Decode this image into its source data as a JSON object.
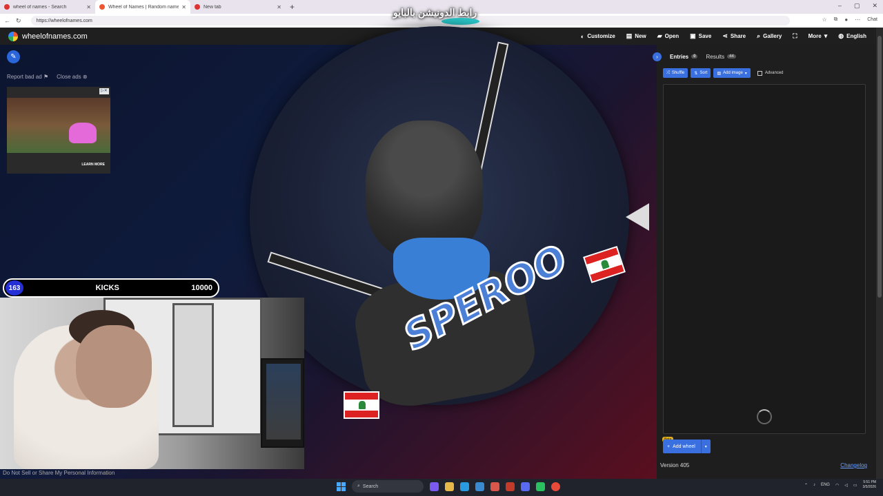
{
  "browser": {
    "tabs": [
      {
        "title": "wheel of names - Search",
        "active": false,
        "color": "#d33"
      },
      {
        "title": "Wheel of Names | Random name",
        "active": true,
        "color": "#e53"
      },
      {
        "title": "New tab",
        "active": false,
        "color": "#d33"
      }
    ],
    "new_tab": "+",
    "window_controls": [
      "–",
      "▢",
      "✕"
    ],
    "overlay_text": "رابط الدونيشن بالبايو",
    "url": "https://wheelofnames.com",
    "copilot_label": "Chat"
  },
  "header": {
    "site_name": "wheelofnames.com",
    "menu": [
      {
        "label": "Customize",
        "icon": "palette-icon"
      },
      {
        "label": "New",
        "icon": "file-icon"
      },
      {
        "label": "Open",
        "icon": "folder-icon"
      },
      {
        "label": "Save",
        "icon": "save-icon"
      },
      {
        "label": "Share",
        "icon": "share-icon"
      },
      {
        "label": "Gallery",
        "icon": "search-icon"
      },
      {
        "label": "",
        "icon": "fullscreen-icon"
      },
      {
        "label": "More",
        "icon": "chevron-down-icon"
      },
      {
        "label": "English",
        "icon": "globe-icon"
      }
    ]
  },
  "ads": {
    "report": "Report bad ad",
    "close": "Close ads",
    "learn_more": "LEARN MORE"
  },
  "wheel": {
    "center_text": "SPEROO"
  },
  "stream": {
    "left_value": "163",
    "label": "KICKS",
    "right_value": "10000"
  },
  "footer": {
    "privacy": "Do Not Sell or Share My Personal Information"
  },
  "panel": {
    "tabs": [
      {
        "label": "Entries",
        "count": "0",
        "active": true
      },
      {
        "label": "Results",
        "count": "44",
        "active": false
      }
    ],
    "buttons": {
      "shuffle": "Shuffle",
      "sort": "Sort",
      "add_image": "Add image",
      "advanced": "Advanced"
    },
    "beta": "Beta",
    "add_wheel": "Add wheel",
    "version": "Version 405",
    "changelog": "Changelog"
  },
  "taskbar": {
    "search": "Search",
    "lang": "ENG",
    "time": "5:51 PM",
    "date": "3/5/2026"
  },
  "colors": {
    "accent": "#3a6fe0",
    "header_bg": "#1f1f1f",
    "panel_bg": "#1e1e1e"
  }
}
